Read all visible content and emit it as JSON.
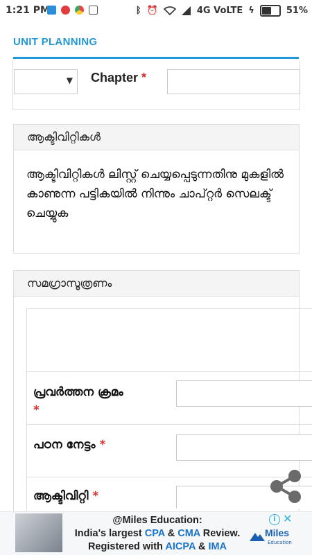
{
  "status_bar": {
    "time": "1:21 PM",
    "network": "4G VoLTE",
    "battery": "51%",
    "battery_level": 0.51
  },
  "header": {
    "title": "UNIT PLANNING"
  },
  "chapter": {
    "label": "Chapter",
    "required_mark": "*",
    "select_value": "",
    "input_value": ""
  },
  "activities_panel": {
    "title": "ആക്ടിവിറ്റികൾ",
    "message": "ആക്ടിവിറ്റികൾ ലിസ്റ്റ് ചെയ്യപ്പെടുന്നതിനു മുകളിൽ കാണുന്ന പട്ടികയിൽ നിന്നും ചാപ്റ്റർ സെലക്ട് ചെയ്യുക"
  },
  "summary_panel": {
    "title": "സമഗ്രാസൂത്രണം",
    "fields": [
      {
        "label": "പ്രവർത്തന ക്രമം",
        "required_mark": "*",
        "value": ""
      },
      {
        "label": "പഠന നേട്ടം",
        "required_mark": "*",
        "value": ""
      },
      {
        "label": "ആക്ടിവിറ്റി",
        "required_mark": "*",
        "value": ""
      }
    ]
  },
  "ad": {
    "line1": "@Miles Education:",
    "line2_pre": "India's largest ",
    "line2_cpa": "CPA",
    "line2_mid": " & ",
    "line2_cma": "CMA",
    "line2_post": " Review.",
    "line3_pre": "Registered with ",
    "line3_aicpa": "AICPA",
    "line3_mid": " & ",
    "line3_ima": "IMA",
    "logo_text": "Miles",
    "logo_sub": "Education",
    "info_glyph": "i",
    "close_glyph": "✕"
  },
  "colors": {
    "accent": "#2196d8",
    "required": "#d9302b",
    "panel_header_bg": "#f4f4f4",
    "border": "#dcdcdc"
  },
  "icons": [
    "usb-icon",
    "record-icon",
    "chrome-icon",
    "nfc-icon",
    "bluetooth-icon",
    "alarm-icon",
    "wifi-icon",
    "signal-icon",
    "charging-icon",
    "battery-icon",
    "chevron-down-icon",
    "share-icon",
    "ad-info-icon",
    "ad-close-icon"
  ]
}
